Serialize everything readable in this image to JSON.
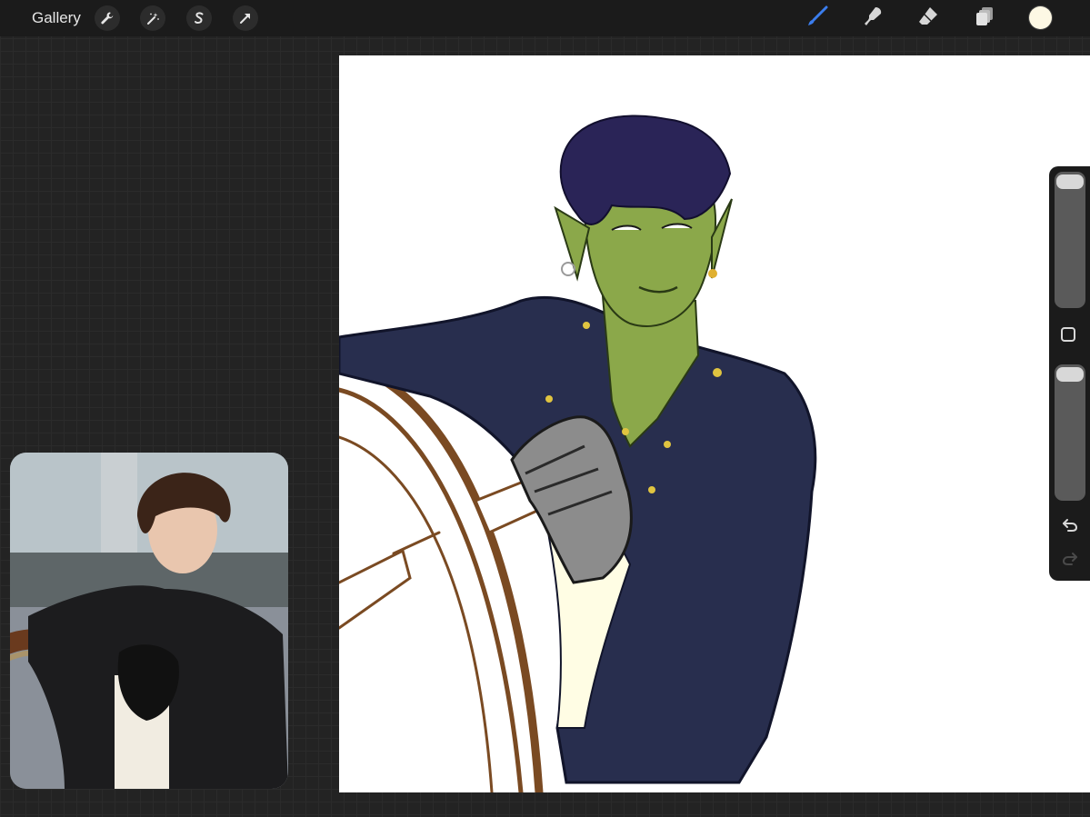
{
  "toolbar": {
    "gallery_label": "Gallery",
    "left_tools": [
      "wrench-icon",
      "magic-wand-icon",
      "selection-icon",
      "transform-icon"
    ],
    "right_tools": [
      "brush-icon",
      "smudge-icon",
      "eraser-icon",
      "layers-icon"
    ],
    "active_tool": "brush",
    "active_tool_color": "#3b7ded",
    "current_color": "#fdf8e4"
  },
  "sidebar": {
    "size_slider_level": 1.0,
    "opacity_slider_level": 1.0,
    "controls": [
      "modify-button",
      "undo-button",
      "redo-button"
    ],
    "redo_enabled": false
  },
  "canvas": {
    "background": "#ffffff"
  },
  "reference": {
    "visible": true
  }
}
